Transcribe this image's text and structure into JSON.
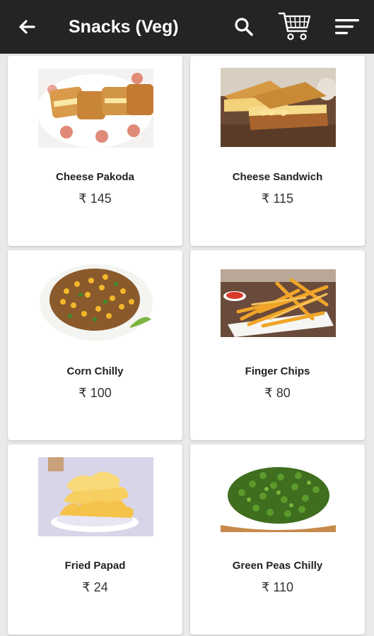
{
  "header": {
    "title": "Snacks (Veg)",
    "back_icon": "arrow-back-icon",
    "search_icon": "search-icon",
    "cart_icon": "cart-icon",
    "menu_icon": "sort-menu-icon",
    "background": "#252323"
  },
  "products": [
    {
      "name": "Cheese Pakoda",
      "price": "₹ 145",
      "image": "cheese-pakoda-image"
    },
    {
      "name": "Cheese Sandwich",
      "price": "₹ 115",
      "image": "cheese-sandwich-image"
    },
    {
      "name": "Corn Chilly",
      "price": "₹ 100",
      "image": "corn-chilly-image"
    },
    {
      "name": "Finger Chips",
      "price": "₹ 80",
      "image": "finger-chips-image"
    },
    {
      "name": "Fried Papad",
      "price": "₹ 24",
      "image": "fried-papad-image"
    },
    {
      "name": "Green Peas Chilly",
      "price": "₹ 110",
      "image": "green-peas-chilly-image"
    }
  ]
}
